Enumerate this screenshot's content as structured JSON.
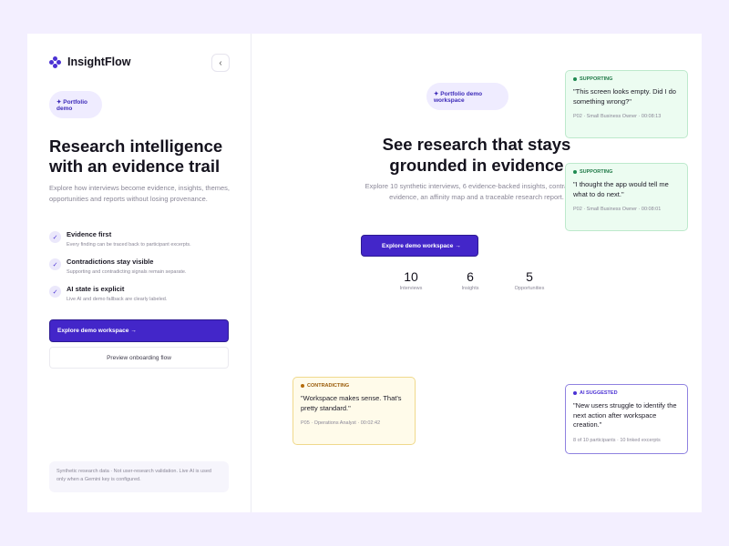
{
  "brand": {
    "name": "InsightFlow"
  },
  "sidebar": {
    "collapse_icon": "chevron-left-icon",
    "pill": "✦ Portfolio demo",
    "headline": "Research intelligence with an evidence trail",
    "intro": "Explore how interviews become evidence, insights, themes, opportunities and reports without losing provenance.",
    "features": [
      {
        "title": "Evidence first",
        "desc": "Every finding can be traced back to participant excerpts."
      },
      {
        "title": "Contradictions stay visible",
        "desc": "Supporting and contradicting signals remain separate."
      },
      {
        "title": "AI state is explicit",
        "desc": "Live AI and demo fallback are clearly labeled."
      }
    ],
    "primary_button": "Explore demo workspace →",
    "secondary_button": "Preview onboarding flow",
    "note": "Synthetic research data · Not user-research validation. Live AI is used only when a Gemini key is configured."
  },
  "main": {
    "pill": "✦ Portfolio demo workspace",
    "title": "See research that stays grounded in evidence",
    "description": "Explore 10 synthetic interviews, 6 evidence-backed insights, contradictory evidence, an affinity map and a traceable research report.",
    "button": "Explore demo workspace →",
    "stats": [
      {
        "value": "10",
        "label": "Interviews"
      },
      {
        "value": "6",
        "label": "Insights"
      },
      {
        "value": "5",
        "label": "Opportunities"
      }
    ]
  },
  "cards": {
    "supporting_1": {
      "tag": "SUPPORTING",
      "quote": "\"This screen looks empty. Did I do something wrong?\"",
      "meta": "P02 · Small Business Owner · 00:08:13"
    },
    "supporting_2": {
      "tag": "SUPPORTING",
      "quote": "\"I thought the app would tell me what to do next.\"",
      "meta": "P02 · Small Business Owner · 00:08:01"
    },
    "contradicting": {
      "tag": "CONTRADICTING",
      "quote": "\"Workspace makes sense. That's pretty standard.\"",
      "meta": "P05 · Operations Analyst · 00:02:42"
    },
    "ai_suggested": {
      "tag": "AI SUGGESTED",
      "quote": "\"New users struggle to identify the next action after workspace creation.\"",
      "meta": "8 of 10 participants · 10 linked excerpts"
    }
  },
  "colors": {
    "accent": "#4326c9",
    "supporting": "#1e8a50",
    "contradicting": "#b56c0a",
    "ai": "#4b32d4"
  }
}
